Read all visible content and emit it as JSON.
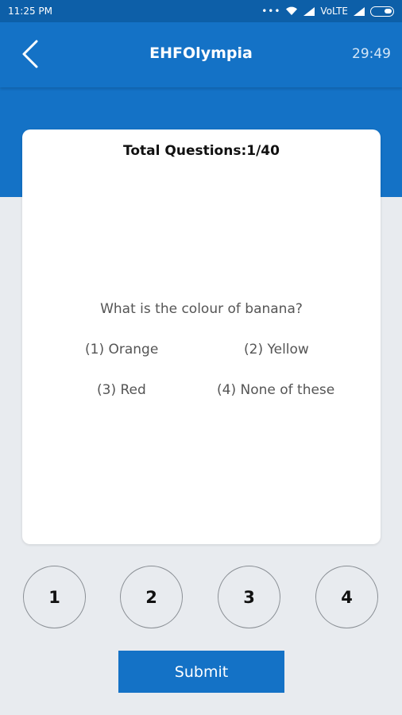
{
  "status_bar": {
    "time": "11:25 PM",
    "network": "VoLTE"
  },
  "app_bar": {
    "title": "EHFOlympia",
    "timer": "29:49",
    "back_icon": "chevron-left-icon"
  },
  "question_card": {
    "header": "Total Questions:1/40",
    "question": "What is the colour of banana?",
    "options": [
      "(1) Orange",
      "(2) Yellow",
      "(3) Red",
      "(4) None of these"
    ]
  },
  "answer_buttons": [
    "1",
    "2",
    "3",
    "4"
  ],
  "submit_label": "Submit",
  "colors": {
    "primary": "#1472c6",
    "status_bar": "#0d5fa8",
    "background": "#e8ebef"
  }
}
